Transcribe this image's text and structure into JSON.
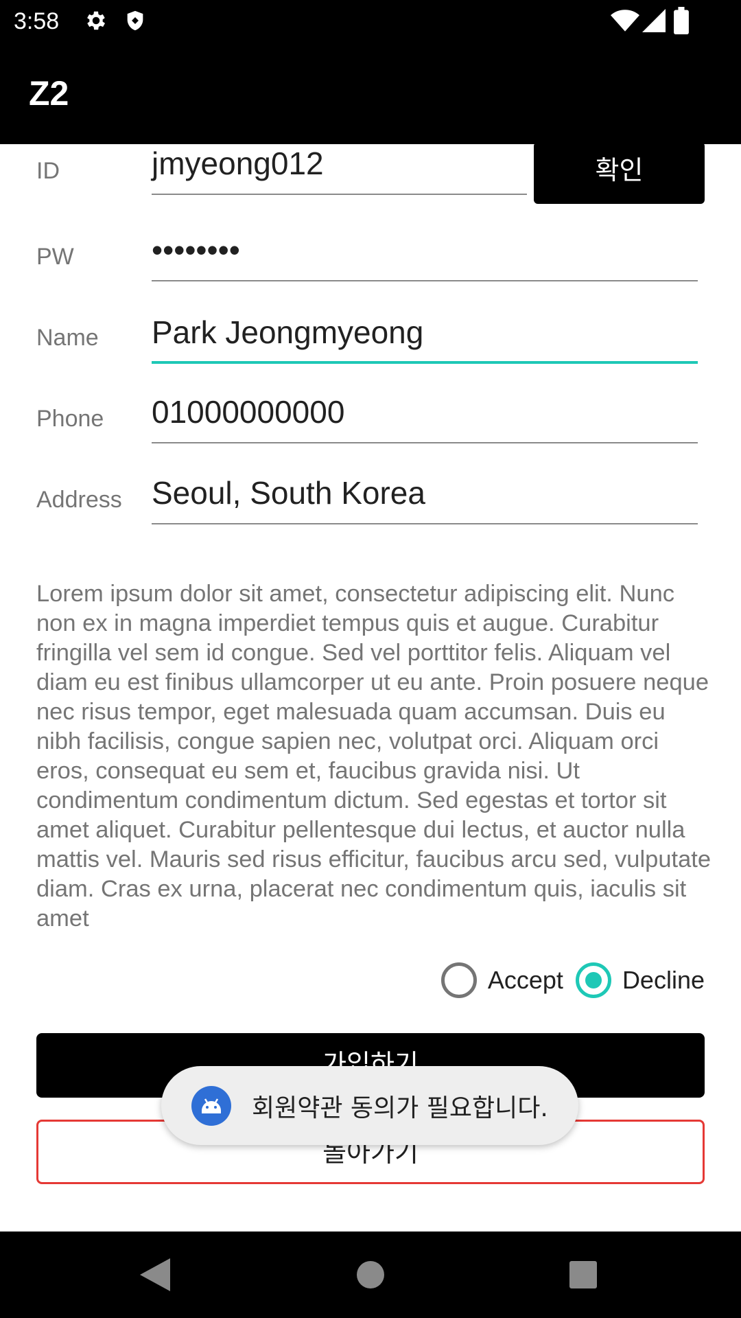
{
  "status_bar": {
    "time": "3:58",
    "icons": [
      "gear-icon",
      "shield-icon",
      "wifi-icon",
      "signal-icon",
      "battery-icon"
    ]
  },
  "app_bar": {
    "title": "Z2"
  },
  "form": {
    "id": {
      "label": "ID",
      "value": "jmyeong012",
      "confirm_label": "확인"
    },
    "pw": {
      "label": "PW",
      "value": "••••••••"
    },
    "name": {
      "label": "Name",
      "value": "Park Jeongmyeong"
    },
    "phone": {
      "label": "Phone",
      "value": "01000000000"
    },
    "address": {
      "label": "Address",
      "value": "Seoul, South Korea"
    }
  },
  "terms_text": "Lorem ipsum dolor sit amet, consectetur adipiscing elit. Nunc non ex in magna imperdiet tempus quis et augue. Curabitur fringilla vel sem id congue. Sed vel porttitor felis. Aliquam vel diam eu est finibus ullamcorper ut eu ante. Proin posuere neque nec risus tempor, eget malesuada quam accumsan. Duis eu nibh facilisis, congue sapien nec, volutpat orci. Aliquam orci eros, consequat eu sem et, faucibus gravida nisi. Ut condimentum condimentum dictum. Sed egestas et tortor sit amet aliquet.  Curabitur pellentesque dui lectus, et auctor nulla mattis vel. Mauris sed risus efficitur, faucibus arcu sed, vulputate diam. Cras ex urna, placerat nec condimentum quis, iaculis sit amet",
  "agreement": {
    "accept_label": "Accept",
    "decline_label": "Decline",
    "selected": "Decline"
  },
  "buttons": {
    "join_label": "가입하기",
    "back_label": "돌아가기"
  },
  "toast": {
    "message": "회원약관 동의가 필요합니다.",
    "icon": "android-icon"
  },
  "nav_bar": {
    "icons": [
      "back-icon",
      "home-icon",
      "recents-icon"
    ]
  },
  "colors": {
    "accent": "#1ec8b6",
    "back_border": "#e53935",
    "toast_icon": "#2f6fd6"
  }
}
